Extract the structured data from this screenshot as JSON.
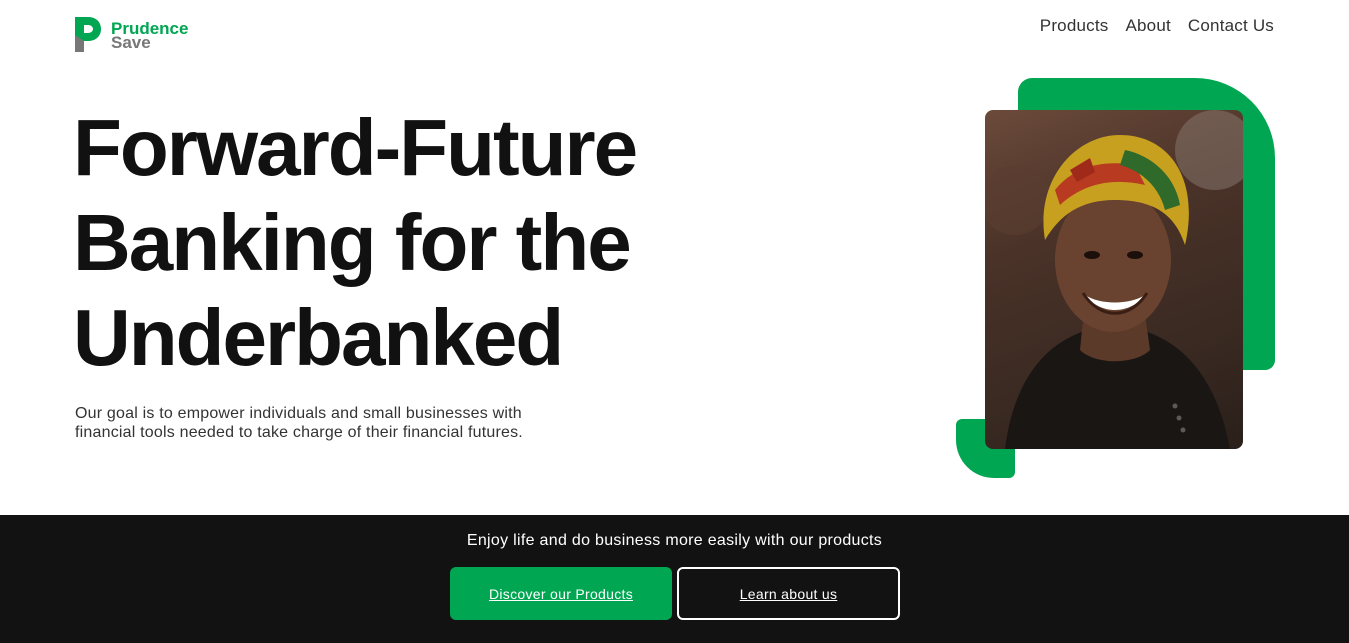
{
  "brand": {
    "name_line1": "Prudence",
    "name_line2": "Save",
    "accent_color": "#00a651"
  },
  "nav": {
    "items": [
      {
        "label": "Products"
      },
      {
        "label": "About"
      },
      {
        "label": "Contact Us"
      }
    ]
  },
  "hero": {
    "title_lines": [
      "Forward-Future",
      "Banking for the",
      "Underbanked"
    ],
    "description_line1": "Our goal is to empower individuals and small businesses with",
    "description_line2": "financial tools needed to take charge of their financial futures."
  },
  "cta": {
    "tagline": "Enjoy life and do business more easily with our products",
    "primary_label": "Discover our Products",
    "secondary_label": "Learn about us"
  }
}
